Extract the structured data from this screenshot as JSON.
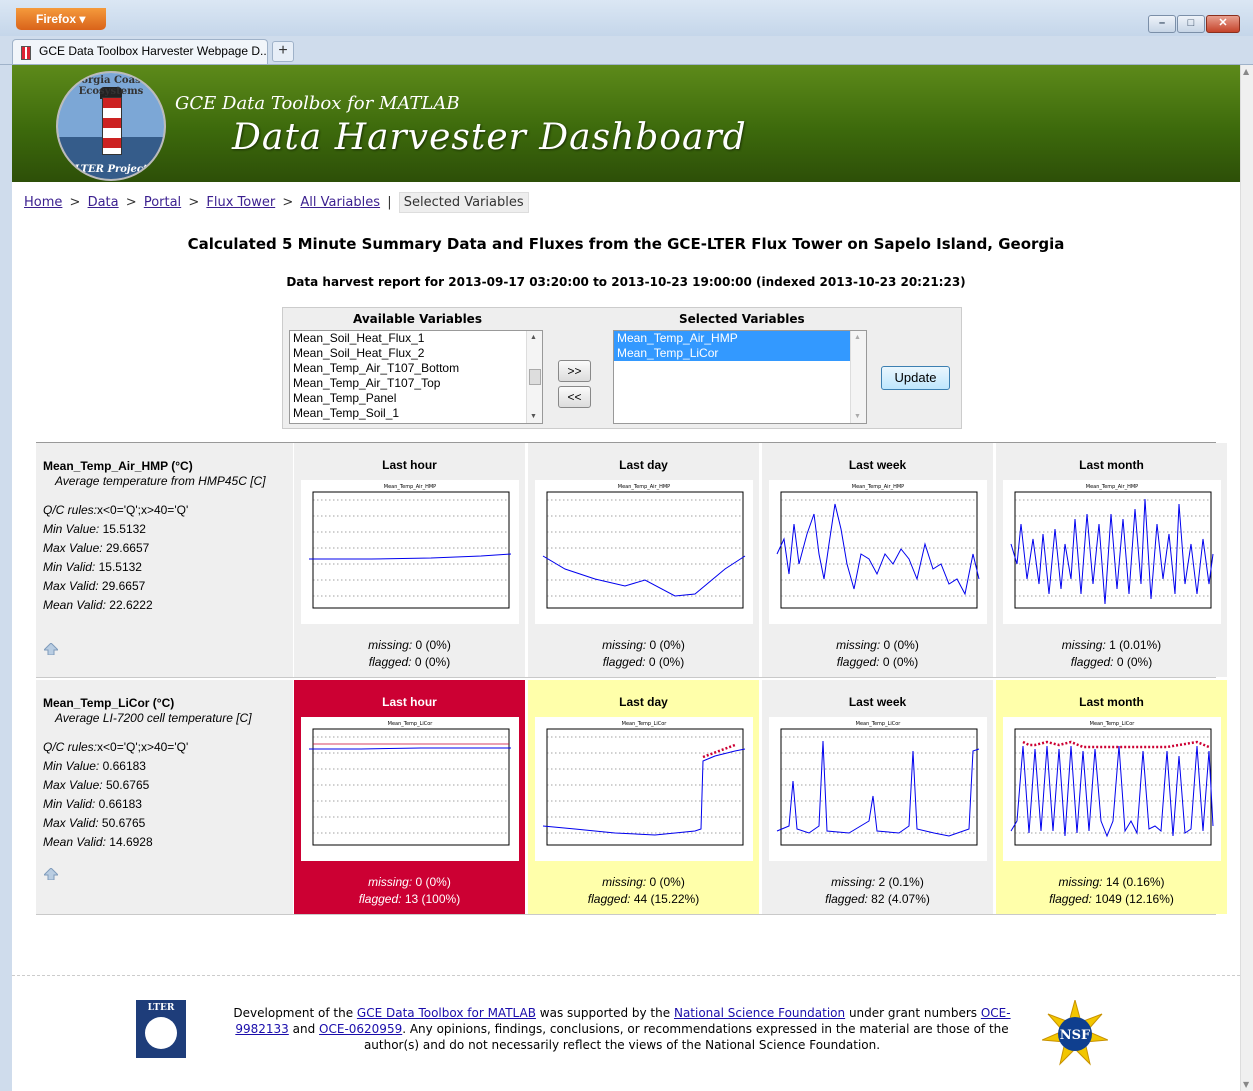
{
  "browser": {
    "menu_label": "Firefox",
    "tab_title": "GCE Data Toolbox Harvester Webpage D...",
    "new_tab_label": "+",
    "window_controls": [
      "minimize",
      "maximize",
      "close"
    ]
  },
  "banner": {
    "subtitle": "GCE Data Toolbox for MATLAB",
    "title": "Data Harvester Dashboard",
    "logo_top_text": "Georgia Coastal Ecosystems",
    "logo_bottom_text": "LTER Project"
  },
  "breadcrumb": {
    "links": [
      "Home",
      "Data",
      "Portal",
      "Flux Tower",
      "All Variables"
    ],
    "separator": ">",
    "divider": "|",
    "current": "Selected Variables"
  },
  "heading": "Calculated 5 Minute Summary Data and Fluxes from the GCE-LTER Flux Tower on Sapelo Island, Georgia",
  "report_line": "Data harvest report for 2013-09-17 03:20:00 to 2013-10-23 19:00:00 (indexed 2013-10-23 20:21:23)",
  "selector": {
    "available_label": "Available Variables",
    "selected_label": "Selected Variables",
    "available": [
      "Mean_Soil_Heat_Flux_1",
      "Mean_Soil_Heat_Flux_2",
      "Mean_Temp_Air_T107_Bottom",
      "Mean_Temp_Air_T107_Top",
      "Mean_Temp_Panel",
      "Mean_Temp_Soil_1"
    ],
    "selected": [
      "Mean_Temp_Air_HMP",
      "Mean_Temp_LiCor"
    ],
    "add_button": ">>",
    "remove_button": "<<",
    "update_button": "Update"
  },
  "variables": [
    {
      "name": "Mean_Temp_Air_HMP (°C)",
      "description": "Average temperature from HMP45C [C]",
      "qc_label": "Q/C rules:",
      "qc_value": "x<0='Q';x>40='Q'",
      "min_value_label": "Min Value:",
      "min_value": "15.5132",
      "max_value_label": "Max Value:",
      "max_value": "29.6657",
      "min_valid_label": "Min Valid:",
      "min_valid": "15.5132",
      "max_valid_label": "Max Valid:",
      "max_valid": "29.6657",
      "mean_valid_label": "Mean Valid:",
      "mean_valid": "22.6222",
      "panels": [
        {
          "title": "Last hour",
          "plot_title": "Mean_Temp_Air_HMP",
          "missing": "0 (0%)",
          "flagged": "0 (0%)",
          "status": "ok"
        },
        {
          "title": "Last day",
          "plot_title": "Mean_Temp_Air_HMP",
          "missing": "0 (0%)",
          "flagged": "0 (0%)",
          "status": "ok"
        },
        {
          "title": "Last week",
          "plot_title": "Mean_Temp_Air_HMP",
          "missing": "0 (0%)",
          "flagged": "0 (0%)",
          "status": "ok"
        },
        {
          "title": "Last month",
          "plot_title": "Mean_Temp_Air_HMP",
          "missing": "1 (0.01%)",
          "flagged": "0 (0%)",
          "status": "ok"
        }
      ]
    },
    {
      "name": "Mean_Temp_LiCor (°C)",
      "description": "Average LI-7200 cell temperature [C]",
      "qc_label": "Q/C rules:",
      "qc_value": "x<0='Q';x>40='Q'",
      "min_value_label": "Min Value:",
      "min_value": "0.66183",
      "max_value_label": "Max Value:",
      "max_value": "50.6765",
      "min_valid_label": "Min Valid:",
      "min_valid": "0.66183",
      "max_valid_label": "Max Valid:",
      "max_valid": "50.6765",
      "mean_valid_label": "Mean Valid:",
      "mean_valid": "14.6928",
      "panels": [
        {
          "title": "Last hour",
          "plot_title": "Mean_Temp_LiCor",
          "missing": "0 (0%)",
          "flagged": "13 (100%)",
          "status": "error"
        },
        {
          "title": "Last day",
          "plot_title": "Mean_Temp_LiCor",
          "missing": "0 (0%)",
          "flagged": "44 (15.22%)",
          "status": "warning"
        },
        {
          "title": "Last week",
          "plot_title": "Mean_Temp_LiCor",
          "missing": "2 (0.1%)",
          "flagged": "82 (4.07%)",
          "status": "ok"
        },
        {
          "title": "Last month",
          "plot_title": "Mean_Temp_LiCor",
          "missing": "14 (0.16%)",
          "flagged": "1049 (12.16%)",
          "status": "warning"
        }
      ]
    }
  ],
  "labels": {
    "missing": "missing:",
    "flagged": "flagged:"
  },
  "colors": {
    "error": "#cc0033",
    "warning": "#ffffaa",
    "ok": "#efefef",
    "plot_line": "#0000ee",
    "flag_marker": "#cc0033"
  },
  "footer": {
    "text_1": "Development of the",
    "link_1": "GCE Data Toolbox for MATLAB",
    "text_2": "was supported by the",
    "link_2": "National Science Foundation",
    "text_3": "under grant numbers",
    "link_3": "OCE-9982133",
    "text_4": "and",
    "link_4": "OCE-0620959",
    "text_5": ". Any opinions, findings, conclusions, or recommendations expressed in the material are those of the author(s) and do not necessarily reflect the views of the National Science Foundation.",
    "lter_logo_text": "LTER",
    "nsf_logo_text": "NSF"
  }
}
